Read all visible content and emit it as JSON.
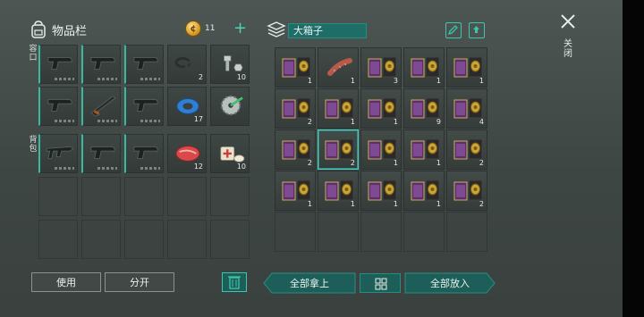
{
  "inventory": {
    "title": "物品栏",
    "coins": "11",
    "plus_label": "+",
    "side_labels": {
      "slots": "容口",
      "backpack": "背包"
    }
  },
  "inv_rows": [
    {
      "cells": [
        {
          "icon": "pistol-icon",
          "qty": "",
          "weapon": true
        },
        {
          "icon": "pistol-icon",
          "qty": "",
          "weapon": true
        },
        {
          "icon": "pistol-icon",
          "qty": "",
          "weapon": true
        },
        {
          "icon": "washers-icon",
          "qty": "2"
        },
        {
          "icon": "bolt-icon",
          "qty": "10"
        }
      ]
    },
    {
      "cells": [
        {
          "icon": "pistol-icon",
          "qty": "",
          "weapon": true
        },
        {
          "icon": "shotgun-icon",
          "qty": "",
          "weapon": true
        },
        {
          "icon": "pistol-icon",
          "qty": "",
          "weapon": true
        },
        {
          "icon": "duct-tape-icon",
          "qty": "17"
        },
        {
          "icon": "saw-blade-icon",
          "qty": ""
        }
      ]
    },
    {
      "cells": [
        {
          "icon": "smg-icon",
          "qty": "",
          "weapon": true
        },
        {
          "icon": "pistol-icon",
          "qty": "",
          "weapon": true
        },
        {
          "icon": "pistol-icon",
          "qty": "",
          "weapon": true
        },
        {
          "icon": "raw-meat-icon",
          "qty": "12"
        },
        {
          "icon": "bandage-icon",
          "qty": "10"
        }
      ]
    }
  ],
  "chest": {
    "name": "大箱子",
    "rows": [
      [
        "1",
        "1",
        "3",
        "1",
        "1"
      ],
      [
        "2",
        "1",
        "1",
        "9",
        "4"
      ],
      [
        "2",
        "2",
        "1",
        "1",
        "2"
      ],
      [
        "1",
        "1",
        "1",
        "1",
        "2"
      ]
    ],
    "sausage_qty": "1"
  },
  "close_label": "关闭",
  "buttons": {
    "use": "使用",
    "split": "分开",
    "take_all": "全部拿上",
    "put_all": "全部放入"
  },
  "colors": {
    "accent": "#3bc6ad",
    "accent_dark": "#1d5f58"
  }
}
